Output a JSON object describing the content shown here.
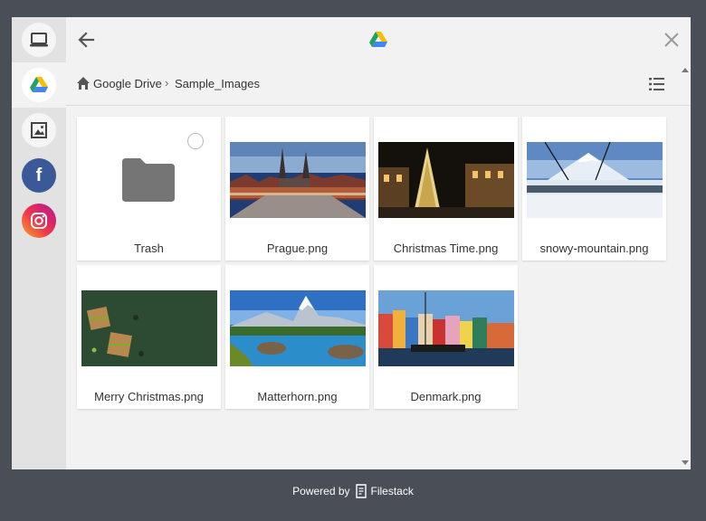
{
  "header": {
    "back_icon": "arrow-left-icon",
    "logo_icon": "google-drive-icon",
    "close_icon": "close-icon"
  },
  "sidebar": {
    "items": [
      {
        "name": "my-device",
        "icon": "laptop-icon"
      },
      {
        "name": "google-drive",
        "icon": "google-drive-icon",
        "active": true
      },
      {
        "name": "image-search",
        "icon": "image-icon"
      },
      {
        "name": "facebook",
        "icon": "facebook-icon",
        "letter": "f"
      },
      {
        "name": "instagram",
        "icon": "instagram-icon"
      }
    ]
  },
  "breadcrumb": {
    "root": "Google Drive",
    "separator": "›",
    "current": "Sample_Images"
  },
  "files": [
    {
      "name": "Trash",
      "type": "folder"
    },
    {
      "name": "Prague.png",
      "type": "image"
    },
    {
      "name": "Christmas Time.png",
      "type": "image"
    },
    {
      "name": "snowy-mountain.png",
      "type": "image"
    },
    {
      "name": "Merry Christmas.png",
      "type": "image"
    },
    {
      "name": "Matterhorn.png",
      "type": "image"
    },
    {
      "name": "Denmark.png",
      "type": "image"
    }
  ],
  "footer": {
    "powered_by": "Powered by",
    "brand": "Filestack"
  },
  "colors": {
    "background": "#4a4f57",
    "dialog": "#f2f2f2",
    "sidebar": "#e2e2e2",
    "facebook": "#3b5998"
  }
}
